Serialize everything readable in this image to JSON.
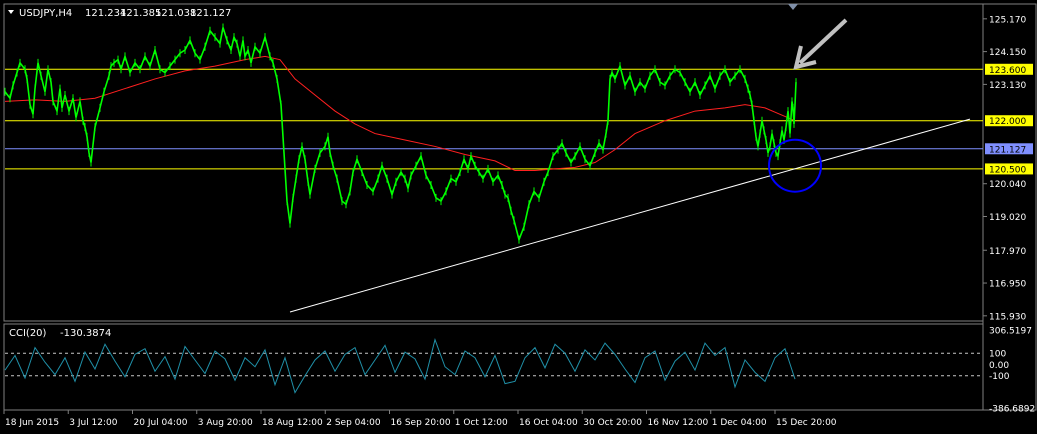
{
  "chart_data": {
    "type": "line",
    "header": {
      "symbol": "USDJPY,H4",
      "open": "121.234",
      "high": "121.385",
      "low": "121.038",
      "close": "121.127"
    },
    "price_axis": {
      "ylim": [
        115.8,
        125.6
      ],
      "ticks": [
        "125.170",
        "124.150",
        "123.130",
        "121.127",
        "120.040",
        "119.020",
        "117.970",
        "116.950",
        "115.930"
      ]
    },
    "time_axis": {
      "labels": [
        "18 Jun 2015",
        "3 Jul 12:00",
        "20 Jul 04:00",
        "3 Aug 20:00",
        "18 Aug 12:00",
        "2 Sep 04:00",
        "16 Sep 20:00",
        "1 Oct 12:00",
        "16 Oct 04:00",
        "30 Oct 20:00",
        "16 Nov 12:00",
        "1 Dec 04:00",
        "15 Dec 20:00"
      ]
    },
    "price_series": {
      "name": "USDJPY,H4",
      "color": "#00ff00",
      "x": [
        0,
        5,
        8,
        12,
        15,
        20,
        22,
        25,
        28,
        30,
        33,
        36,
        40,
        43,
        46,
        48,
        52,
        55,
        57,
        60,
        64,
        68,
        71,
        75,
        78,
        80,
        82,
        84,
        86,
        90,
        95,
        99,
        104,
        106,
        109,
        113,
        116,
        120,
        125,
        130,
        135,
        140,
        145,
        150,
        155,
        160,
        165,
        170,
        175,
        180,
        185,
        190,
        195,
        200,
        205,
        210,
        215,
        218,
        222,
        226,
        229,
        232,
        235,
        238,
        240,
        243,
        246,
        250,
        255,
        260,
        265,
        268,
        272,
        276,
        279,
        282,
        285,
        288,
        291,
        294,
        297,
        300,
        303,
        305,
        310,
        315,
        320,
        323,
        325,
        328,
        332,
        337,
        341,
        345,
        348,
        352,
        357,
        362,
        368,
        373,
        377,
        382,
        387,
        391,
        396,
        400,
        403,
        406,
        411,
        416,
        421,
        426,
        431,
        436,
        441,
        446,
        451,
        455,
        459,
        463,
        466,
        470,
        474,
        478,
        483,
        488,
        493,
        497,
        500,
        503,
        506,
        509,
        514,
        519,
        524,
        529,
        534,
        539,
        543,
        548,
        553,
        557,
        561,
        566,
        570,
        575,
        580,
        585,
        590,
        594,
        598,
        601,
        603,
        605,
        607,
        610,
        615,
        620,
        625,
        630,
        635,
        640,
        645,
        650,
        655,
        660,
        665,
        670,
        675,
        680,
        685,
        690,
        695,
        700,
        705,
        710,
        715,
        720,
        725,
        730,
        735,
        740,
        743,
        745,
        747,
        749,
        751,
        753,
        755,
        757,
        759,
        761,
        763,
        765,
        767,
        769,
        771,
        773,
        775,
        777,
        779,
        781,
        783,
        784,
        785,
        786,
        787,
        788,
        789,
        790,
        791
      ],
      "y": [
        122.9,
        122.7,
        123.1,
        123.5,
        123.8,
        123.6,
        123.3,
        122.5,
        122.2,
        123.0,
        123.8,
        123.4,
        122.9,
        123.6,
        123.2,
        122.6,
        122.3,
        123.0,
        122.4,
        122.8,
        122.3,
        122.7,
        122.1,
        122.6,
        122.0,
        121.8,
        121.5,
        121.0,
        120.7,
        121.8,
        122.4,
        122.9,
        123.4,
        123.7,
        123.8,
        123.9,
        123.6,
        124.0,
        123.5,
        123.8,
        123.6,
        124.0,
        123.7,
        124.2,
        123.6,
        123.5,
        123.7,
        123.9,
        124.1,
        124.2,
        124.5,
        124.1,
        123.9,
        124.3,
        124.8,
        124.6,
        124.4,
        124.9,
        124.5,
        124.2,
        124.6,
        124.4,
        124.0,
        124.5,
        124.0,
        124.2,
        123.8,
        124.3,
        124.1,
        124.6,
        124.0,
        123.8,
        123.3,
        122.5,
        121.0,
        119.5,
        118.8,
        119.6,
        120.2,
        120.8,
        121.2,
        120.8,
        120.1,
        119.7,
        120.5,
        121.0,
        121.2,
        121.5,
        121.0,
        120.6,
        120.2,
        119.5,
        119.4,
        119.8,
        120.4,
        120.8,
        120.4,
        120.0,
        119.8,
        120.2,
        120.6,
        120.2,
        119.7,
        120.1,
        120.4,
        120.2,
        119.9,
        120.3,
        120.6,
        120.9,
        120.3,
        120.0,
        119.6,
        119.5,
        119.8,
        120.2,
        120.1,
        120.4,
        120.8,
        120.5,
        120.9,
        120.6,
        120.4,
        120.2,
        120.5,
        120.1,
        120.3,
        120.0,
        119.7,
        119.6,
        119.2,
        118.9,
        118.3,
        118.7,
        119.4,
        119.8,
        119.6,
        120.1,
        120.4,
        120.9,
        121.1,
        121.3,
        121.0,
        120.7,
        120.9,
        121.2,
        120.8,
        120.6,
        121.0,
        121.3,
        121.1,
        121.6,
        122.0,
        123.3,
        123.5,
        123.3,
        123.7,
        123.1,
        123.4,
        122.9,
        123.2,
        123.0,
        123.4,
        123.6,
        123.2,
        123.1,
        123.4,
        123.6,
        123.5,
        123.2,
        122.9,
        123.2,
        122.8,
        123.1,
        123.4,
        123.0,
        123.4,
        123.6,
        123.2,
        123.4,
        123.6,
        123.3,
        123.0,
        122.8,
        122.5,
        122.0,
        121.5,
        121.2,
        121.6,
        122.0,
        121.7,
        121.4,
        121.0,
        121.2,
        121.6,
        121.3,
        121.0,
        120.9,
        121.3,
        121.7,
        121.4,
        121.8,
        122.3,
        122.0,
        121.6,
        122.1,
        122.6,
        122.4,
        121.9,
        122.5,
        123.2,
        123.6,
        122.6,
        122.0,
        121.2,
        121.4,
        121.1
      ]
    },
    "ma_series": {
      "color": "#ff2020",
      "x": [
        0,
        30,
        60,
        90,
        120,
        150,
        180,
        210,
        240,
        260,
        275,
        290,
        310,
        330,
        350,
        370,
        400,
        430,
        460,
        490,
        510,
        530,
        550,
        570,
        590,
        610,
        630,
        660,
        690,
        720,
        740,
        760,
        775,
        790
      ],
      "y": [
        122.6,
        122.65,
        122.6,
        122.7,
        123.0,
        123.3,
        123.55,
        123.7,
        123.9,
        124.0,
        123.9,
        123.3,
        122.8,
        122.3,
        121.9,
        121.6,
        121.4,
        121.2,
        120.95,
        120.75,
        120.45,
        120.45,
        120.5,
        120.55,
        120.7,
        121.1,
        121.6,
        122.0,
        122.3,
        122.4,
        122.5,
        122.4,
        122.2,
        122.0
      ]
    },
    "horizontal_levels": [
      {
        "value": 123.6,
        "label": "123.600",
        "color": "#ffff00"
      },
      {
        "value": 122.0,
        "label": "122.000",
        "color": "#ffff00"
      },
      {
        "value": 121.127,
        "label": "121.127",
        "color": "#7f8fff"
      },
      {
        "value": 120.5,
        "label": "120.500",
        "color": "#ffff00"
      }
    ],
    "trendline": {
      "color": "#ffffff",
      "points": [
        {
          "x": 285,
          "y": 116.05
        },
        {
          "x": 965,
          "y": 122.05
        }
      ]
    },
    "annotations": {
      "arrow_color": "#c0c0c0",
      "circle_color": "#0000ff",
      "circle_center": {
        "x": 790,
        "y": 120.6
      }
    },
    "cci": {
      "label": "CCI(20)",
      "value": "-130.3874",
      "color": "#2090a8",
      "ylim": [
        -386.6892,
        306.5197
      ],
      "ticks": [
        "306.5197",
        "100",
        "0.00",
        "-100",
        "-386.6892"
      ],
      "levels": [
        100,
        -100
      ],
      "x": [
        0,
        10,
        20,
        30,
        40,
        50,
        60,
        70,
        80,
        90,
        100,
        110,
        120,
        130,
        140,
        150,
        160,
        170,
        180,
        190,
        200,
        210,
        220,
        230,
        240,
        250,
        260,
        270,
        280,
        290,
        300,
        310,
        320,
        330,
        340,
        350,
        360,
        370,
        380,
        390,
        400,
        410,
        420,
        430,
        440,
        450,
        460,
        470,
        480,
        490,
        500,
        510,
        520,
        530,
        540,
        550,
        560,
        570,
        580,
        590,
        600,
        610,
        620,
        630,
        640,
        650,
        660,
        670,
        680,
        690,
        700,
        710,
        720,
        730,
        740,
        750,
        760,
        770,
        780,
        790
      ],
      "y": [
        -50,
        80,
        -120,
        150,
        20,
        -90,
        60,
        -150,
        110,
        -40,
        180,
        30,
        -110,
        90,
        140,
        -60,
        70,
        -130,
        160,
        40,
        -80,
        120,
        50,
        -140,
        60,
        -20,
        130,
        -180,
        60,
        -250,
        -100,
        40,
        120,
        -60,
        90,
        150,
        -90,
        40,
        170,
        -70,
        110,
        50,
        -130,
        220,
        -20,
        -90,
        120,
        60,
        -110,
        80,
        -170,
        -150,
        60,
        150,
        -30,
        180,
        100,
        -60,
        130,
        40,
        190,
        90,
        -40,
        -160,
        60,
        120,
        -140,
        30,
        110,
        -50,
        190,
        80,
        150,
        -200,
        40,
        -70,
        -150,
        60,
        140,
        -130
      ]
    }
  }
}
